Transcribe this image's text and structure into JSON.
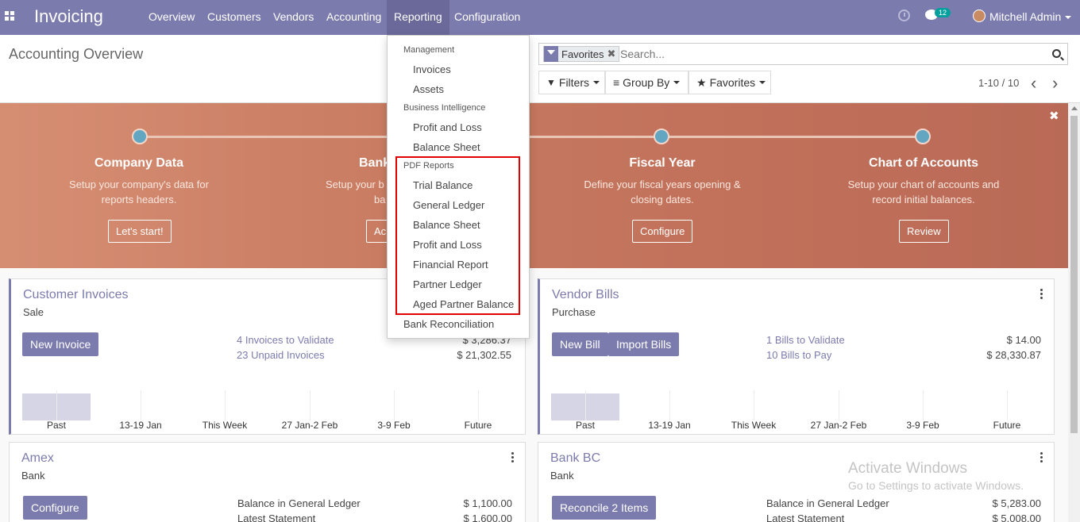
{
  "navbar": {
    "brand": "Invoicing",
    "menu": [
      {
        "label": "Overview"
      },
      {
        "label": "Customers"
      },
      {
        "label": "Vendors"
      },
      {
        "label": "Accounting"
      },
      {
        "label": "Reporting"
      },
      {
        "label": "Configuration"
      }
    ],
    "messages_count": "12",
    "user_name": "Mitchell Admin",
    "accent_color": "#7c7bad"
  },
  "control_panel": {
    "title": "Accounting Overview",
    "facet_label": "Favorites",
    "facet_remove": "✖",
    "search_placeholder": "Search...",
    "filters_label": "Filters",
    "group_by_label": "Group By",
    "favorites_label": "Favorites",
    "pager": "1-10 / 10",
    "pager_prev": "‹",
    "pager_next": "›"
  },
  "banner": {
    "close": "✖",
    "steps": [
      {
        "title": "Company Data",
        "desc1": "Setup your company's data for",
        "desc2": "reports headers.",
        "button": "Let's start!"
      },
      {
        "title": "Bank",
        "desc1": "Setup your b",
        "desc2": "ba",
        "button": "Ac"
      },
      {
        "title": "Fiscal Year",
        "desc1": "Define your fiscal years opening &",
        "desc2": "closing dates.",
        "button": "Configure"
      },
      {
        "title": "Chart of Accounts",
        "desc1": "Setup your chart of accounts and",
        "desc2": "record initial balances.",
        "button": "Review"
      }
    ]
  },
  "reporting_menu": {
    "management_header": "Management",
    "invoices": "Invoices",
    "assets": "Assets",
    "bi_header": "Business Intelligence",
    "profit_loss": "Profit and Loss",
    "balance_sheet": "Balance Sheet",
    "pdf_header": "PDF Reports",
    "pdf_items": [
      "Trial Balance",
      "General Ledger",
      "Balance Sheet",
      "Profit and Loss",
      "Financial Report",
      "Partner Ledger",
      "Aged Partner Balance"
    ],
    "bank_reconciliation": "Bank Reconciliation"
  },
  "cards": {
    "customer_invoices": {
      "title": "Customer Invoices",
      "subtitle": "Sale",
      "button": "New Invoice",
      "link1": "4 Invoices to Validate",
      "amount1": "$ 3,286.37",
      "link2": "23 Unpaid Invoices",
      "amount2": "$ 21,302.55"
    },
    "vendor_bills": {
      "title": "Vendor Bills",
      "subtitle": "Purchase",
      "button1": "New Bill",
      "button2": "Import Bills",
      "link1": "1 Bills to Validate",
      "amount1": "$ 14.00",
      "link2": "10 Bills to Pay",
      "amount2": "$ 28,330.87"
    },
    "amex": {
      "title": "Amex",
      "subtitle": "Bank",
      "button": "Configure",
      "label1": "Balance in General Ledger",
      "amount1": "$ 1,100.00",
      "label2": "Latest Statement",
      "amount2": "$ 1,600.00"
    },
    "bank_bc": {
      "title": "Bank BC",
      "subtitle": "Bank",
      "button": "Reconcile 2 Items",
      "label1": "Balance in General Ledger",
      "amount1": "$ 5,283.00",
      "label2": "Latest Statement",
      "amount2": "$ 5,008.00"
    }
  },
  "graph_labels": [
    "Past",
    "13-19 Jan",
    "This Week",
    "27 Jan-2 Feb",
    "3-9 Feb",
    "Future"
  ],
  "watermark": {
    "line1": "Activate Windows",
    "line2": "Go to Settings to activate Windows."
  }
}
